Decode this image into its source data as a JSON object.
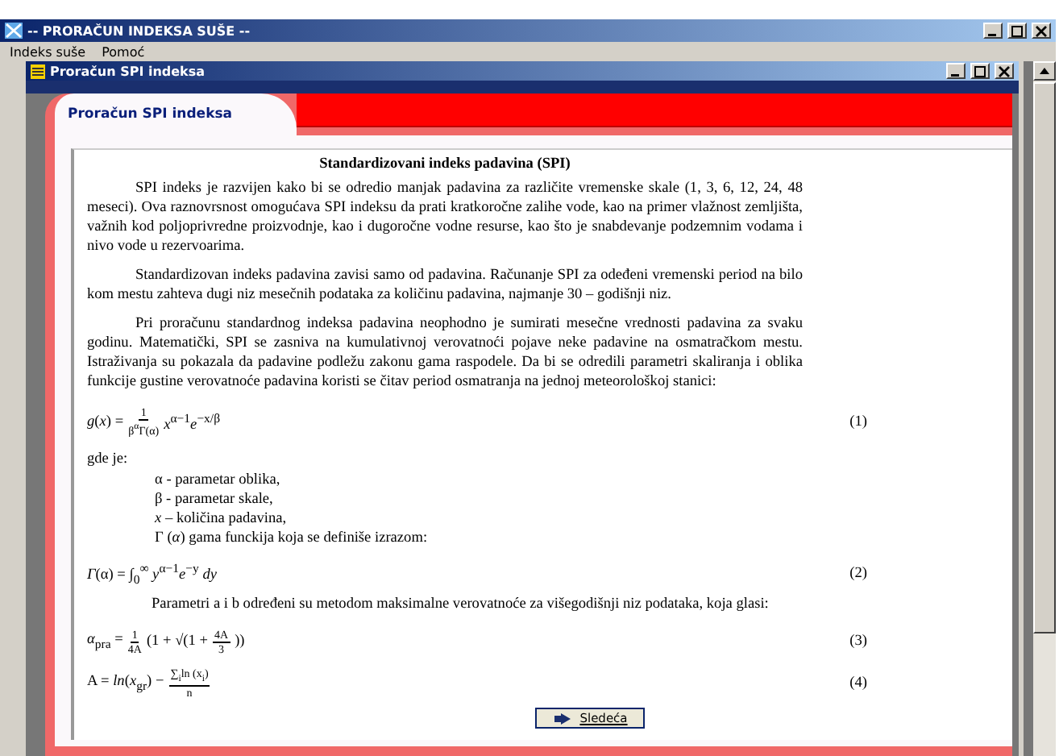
{
  "window": {
    "title": "-- PRORAČUN INDEKSA SUŠE --"
  },
  "menu": [
    "Indeks suše",
    "Pomoć"
  ],
  "child_window": {
    "title": "Proračun SPI indeksa"
  },
  "panel": {
    "tab": "Proračun SPI indeksa"
  },
  "document": {
    "heading": "Standardizovani indeks padavina (SPI)",
    "blocks": [
      {
        "kind": "para",
        "text": "SPI indeks je razvijen kako bi se odredio manjak padavina za različite vremenske skale (1, 3, 6, 12, 24, 48 meseci). Ova raznovrsnost omogućava SPI indeksu da prati kratkoročne zalihe vode, kao na primer vlažnost zemljišta, važnih kod poljoprivredne proizvodnje, kao i dugoročne vodne resurse, kao što je snabdevanje podzemnim vodama i nivo vode u rezervoarima."
      },
      {
        "kind": "para",
        "text": "Standardizovan indeks padavina zavisi samo od padavina. Računanje SPI za odeđeni vremenski period na bilo kom mestu zahteva dugi niz mesečnih podataka za količinu padavina, najmanje 30 – godišnji niz."
      },
      {
        "kind": "para",
        "text": "Pri proračunu standardnog indeksa padavina neophodno je sumirati mesečne vrednosti padavina za svaku godinu. Matematički, SPI se zasniva na kumulativnoj verovatnoći pojave neke padavine na osmatračkom mestu. Istraživanja su pokazala da padavine podležu zakonu gama raspodele. Da bi se odredili parametri skaliranja i oblika funkcije gustine verovatnoće padavina koristi se čitav period osmatranja na jednoj meteorološkoj stanici:"
      },
      {
        "kind": "formula",
        "number": "(1)",
        "parts": [
          {
            "kind": "text",
            "s": "*g*(*x*) ="
          },
          {
            "kind": "frac",
            "num": "1",
            "den": "β$^{α}$Γ(α)"
          },
          {
            "kind": "text",
            "s": "*x*$^{α−1}$*e*$^{−x/β}$"
          }
        ]
      },
      {
        "kind": "plain",
        "text": "gde je:"
      },
      {
        "kind": "list",
        "items": [
          "α - parametar oblika,",
          "β - parametar skale,",
          "*x* – količina padavina,",
          "Γ (*α*) gama funckija koja se definiše izrazom:"
        ]
      },
      {
        "kind": "formula",
        "number": "(2)",
        "parts": [
          {
            "kind": "text",
            "s": "*Γ*(α) = ∫$_{0}$$^{∞}$ *y*$^{α−1}$*e*$^{−y}$ *dy*"
          }
        ]
      },
      {
        "kind": "para_tight",
        "text": "Parametri a i b određeni su metodom maksimalne verovatnoće za višegodišnji niz podataka, koja glasi:"
      },
      {
        "kind": "formula",
        "number": "(3)",
        "parts": [
          {
            "kind": "text",
            "s": "*α*$_{pra}$ ="
          },
          {
            "kind": "frac",
            "num": "1",
            "den": "4A"
          },
          {
            "kind": "text",
            "s": "(1 + √(1 +"
          },
          {
            "kind": "frac",
            "num": "4A",
            "den": "3"
          },
          {
            "kind": "text",
            "s": "))"
          }
        ]
      },
      {
        "kind": "formula",
        "number": "(4)",
        "parts": [
          {
            "kind": "text",
            "s": "A = *ln*(*x*$_{gr}$) −"
          },
          {
            "kind": "frac",
            "num": "∑$_{i}$ln (x$_{i}$)",
            "den": "n"
          }
        ]
      }
    ],
    "next_button": "Sledeća"
  }
}
